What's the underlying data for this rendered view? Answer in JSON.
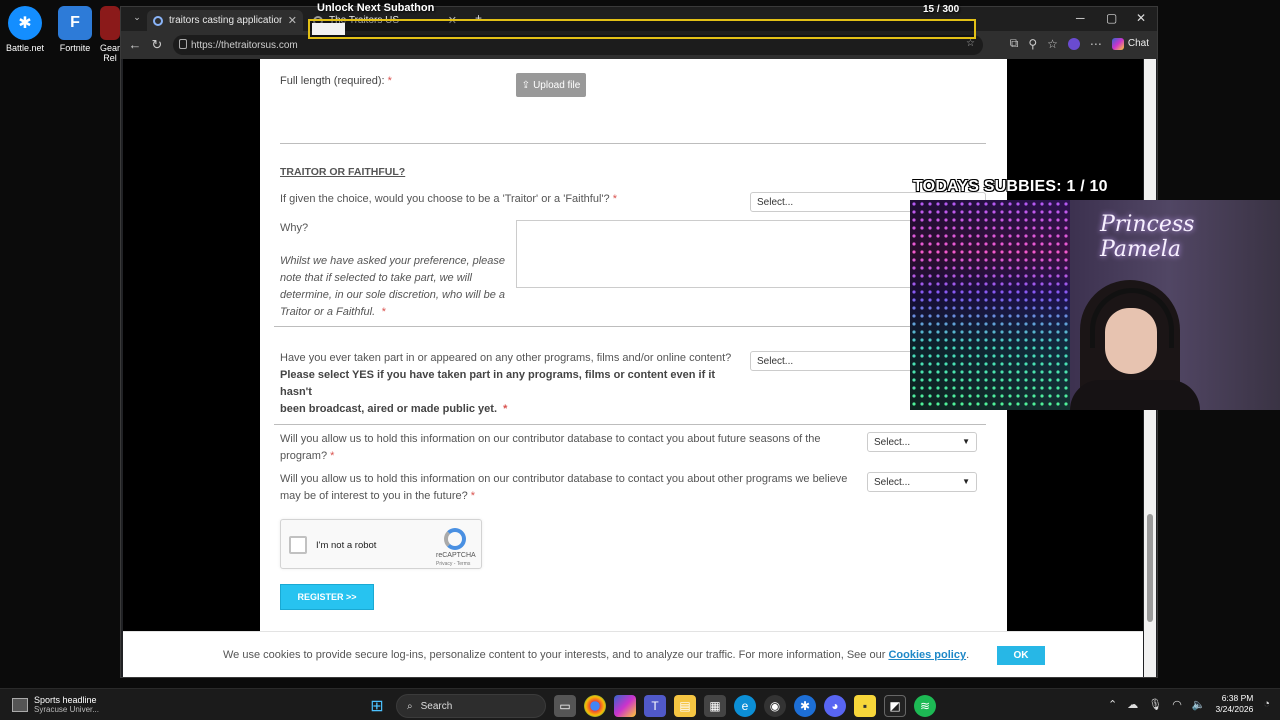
{
  "desktop": {
    "icons": [
      {
        "label": "Battle.net",
        "color": "#148eff",
        "glyph": "✱"
      },
      {
        "label": "Fortnite",
        "color": "#2d7bd8",
        "glyph": "F"
      },
      {
        "label": "Gear Rel",
        "color": "#c0392b",
        "glyph": ""
      }
    ]
  },
  "browser": {
    "tabs": [
      {
        "title": "traitors casting application - Goog"
      },
      {
        "title": "The Traitors US"
      }
    ],
    "new_tab_icon": "plus-icon",
    "url": "https://thetraitorsus.com",
    "chat_label": "Chat"
  },
  "form": {
    "full_length_label": "Full length (required):",
    "required_mark": "*",
    "upload_label": "Upload file",
    "section_title": "TRAITOR OR FAITHFUL?",
    "q_traitor": "If given the choice, would you choose to be a 'Traitor' or a 'Faithful'?",
    "select_placeholder": "Select...",
    "why_label": "Why?",
    "why_note_1": "Whilst we have asked your preference, please",
    "why_note_2": "note that if selected to take part, we will",
    "why_note_3": "determine, in our sole discretion, who will be a",
    "why_note_4": "Traitor or a Faithful.",
    "q_programs": "Have you ever taken part in or appeared on any other programs, films and/or online content?",
    "q_programs_bold_1": "Please select YES if you have taken part in any programs, films or content even if it hasn't",
    "q_programs_bold_2": "been broadcast, aired or made public yet.",
    "q_hold_seasons_1": "Will you allow us to hold this information on our contributor database to contact you about future seasons of the",
    "q_hold_seasons_2": "program?",
    "q_hold_programs_1": "Will you allow us to hold this information on our contributor database to contact you about other programs we believe",
    "q_hold_programs_2": "may be of interest to you in the future?",
    "captcha_label": "I'm not a robot",
    "captcha_brand": "reCAPTCHA",
    "captcha_terms": "Privacy - Terms",
    "register_label": "REGISTER >>"
  },
  "cookie": {
    "text": "We use cookies to provide secure log-ins, personalize content to your interests, and to analyze our traffic. For more information, See our",
    "link": "Cookies policy",
    "period": ".",
    "ok": "OK"
  },
  "overlay": {
    "subathon_title": "Unlock Next Subathon",
    "subathon_count": "15 / 300",
    "subathon_progress": 0.05,
    "subbies_label": "TODAYS SUBBIES:",
    "subbies_count": "1 / 10",
    "streamer_name": "Princess Pamela"
  },
  "taskbar": {
    "news_title": "Sports headline",
    "news_sub": "Syracuse Univer...",
    "search_label": "Search",
    "time": "6:38 PM",
    "date": "3/24/2026"
  },
  "colors": {
    "accent": "#27c3f0",
    "required": "#d9534f",
    "overlay_border": "#e2c016"
  }
}
